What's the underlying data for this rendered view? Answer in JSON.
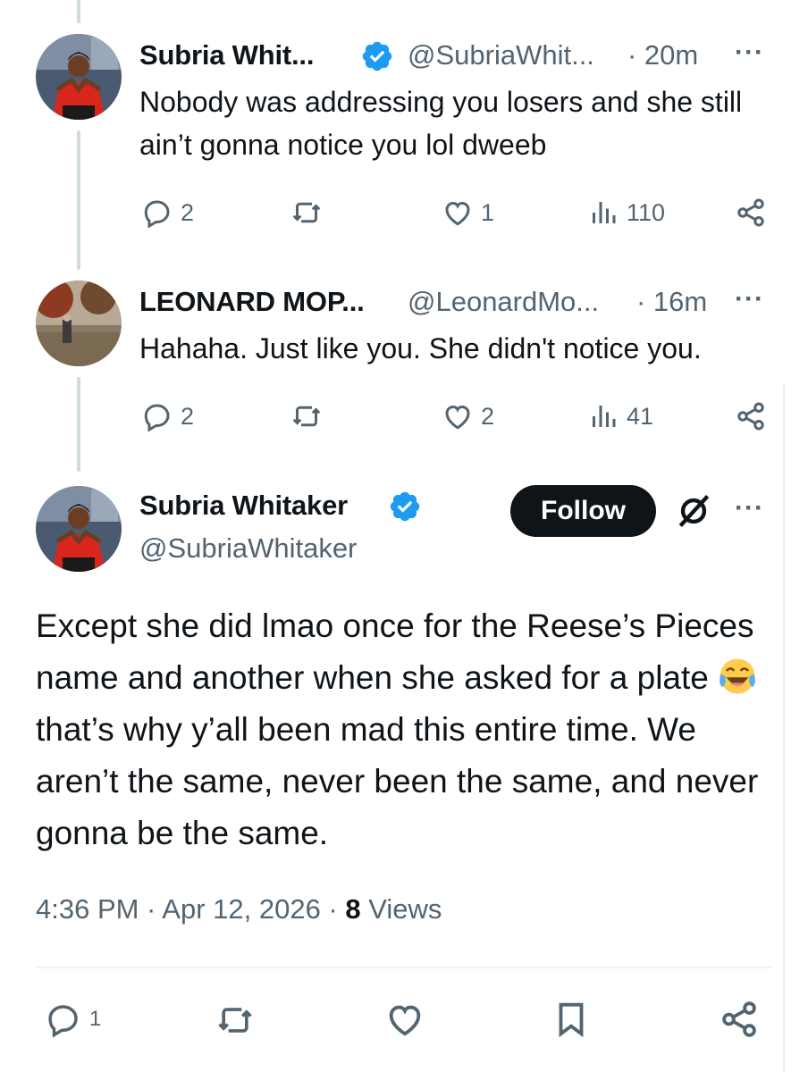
{
  "reply1": {
    "name": "Subria Whit...",
    "handle": "@SubriaWhit...",
    "time": "· 20m",
    "more": "···",
    "text": "Nobody was addressing you losers and she still ain’t gonna notice you lol dweeb",
    "replies": "2",
    "likes": "1",
    "views": "110"
  },
  "reply2": {
    "name": "LEONARD MOP...",
    "handle": "@LeonardMo...",
    "time": "· 16m",
    "more": "···",
    "text": "Hahaha. Just like you. She didn't notice you.",
    "replies": "2",
    "likes": "2",
    "views": "41"
  },
  "main": {
    "name": "Subria Whitaker",
    "handle": "@SubriaWhitaker",
    "follow_label": "Follow",
    "more": "···",
    "text_before_emoji": "Except she did lmao once for the Reese’s Pieces name and another when she asked for a plate ",
    "text_after_emoji": " that’s why y’all been mad this entire time. We aren’t the same, never been the same, and never gonna be the same.",
    "time": "4:36 PM · Apr 12, 2026 · ",
    "views_count": "8",
    "views_label": " Views",
    "replies": "1"
  },
  "icons": {
    "verified": "verified-badge-icon",
    "reply": "speech-bubble-icon",
    "retweet": "retweet-icon",
    "like": "heart-icon",
    "views": "bar-chart-icon",
    "share": "share-icon",
    "bookmark": "bookmark-icon",
    "grok": "grok-icon",
    "laugh_emoji": "tears-of-joy-emoji-icon"
  },
  "colors": {
    "verified": "#1d9bf0",
    "text": "#0f1419",
    "secondary": "#536471",
    "follow_bg": "#0f1419"
  }
}
